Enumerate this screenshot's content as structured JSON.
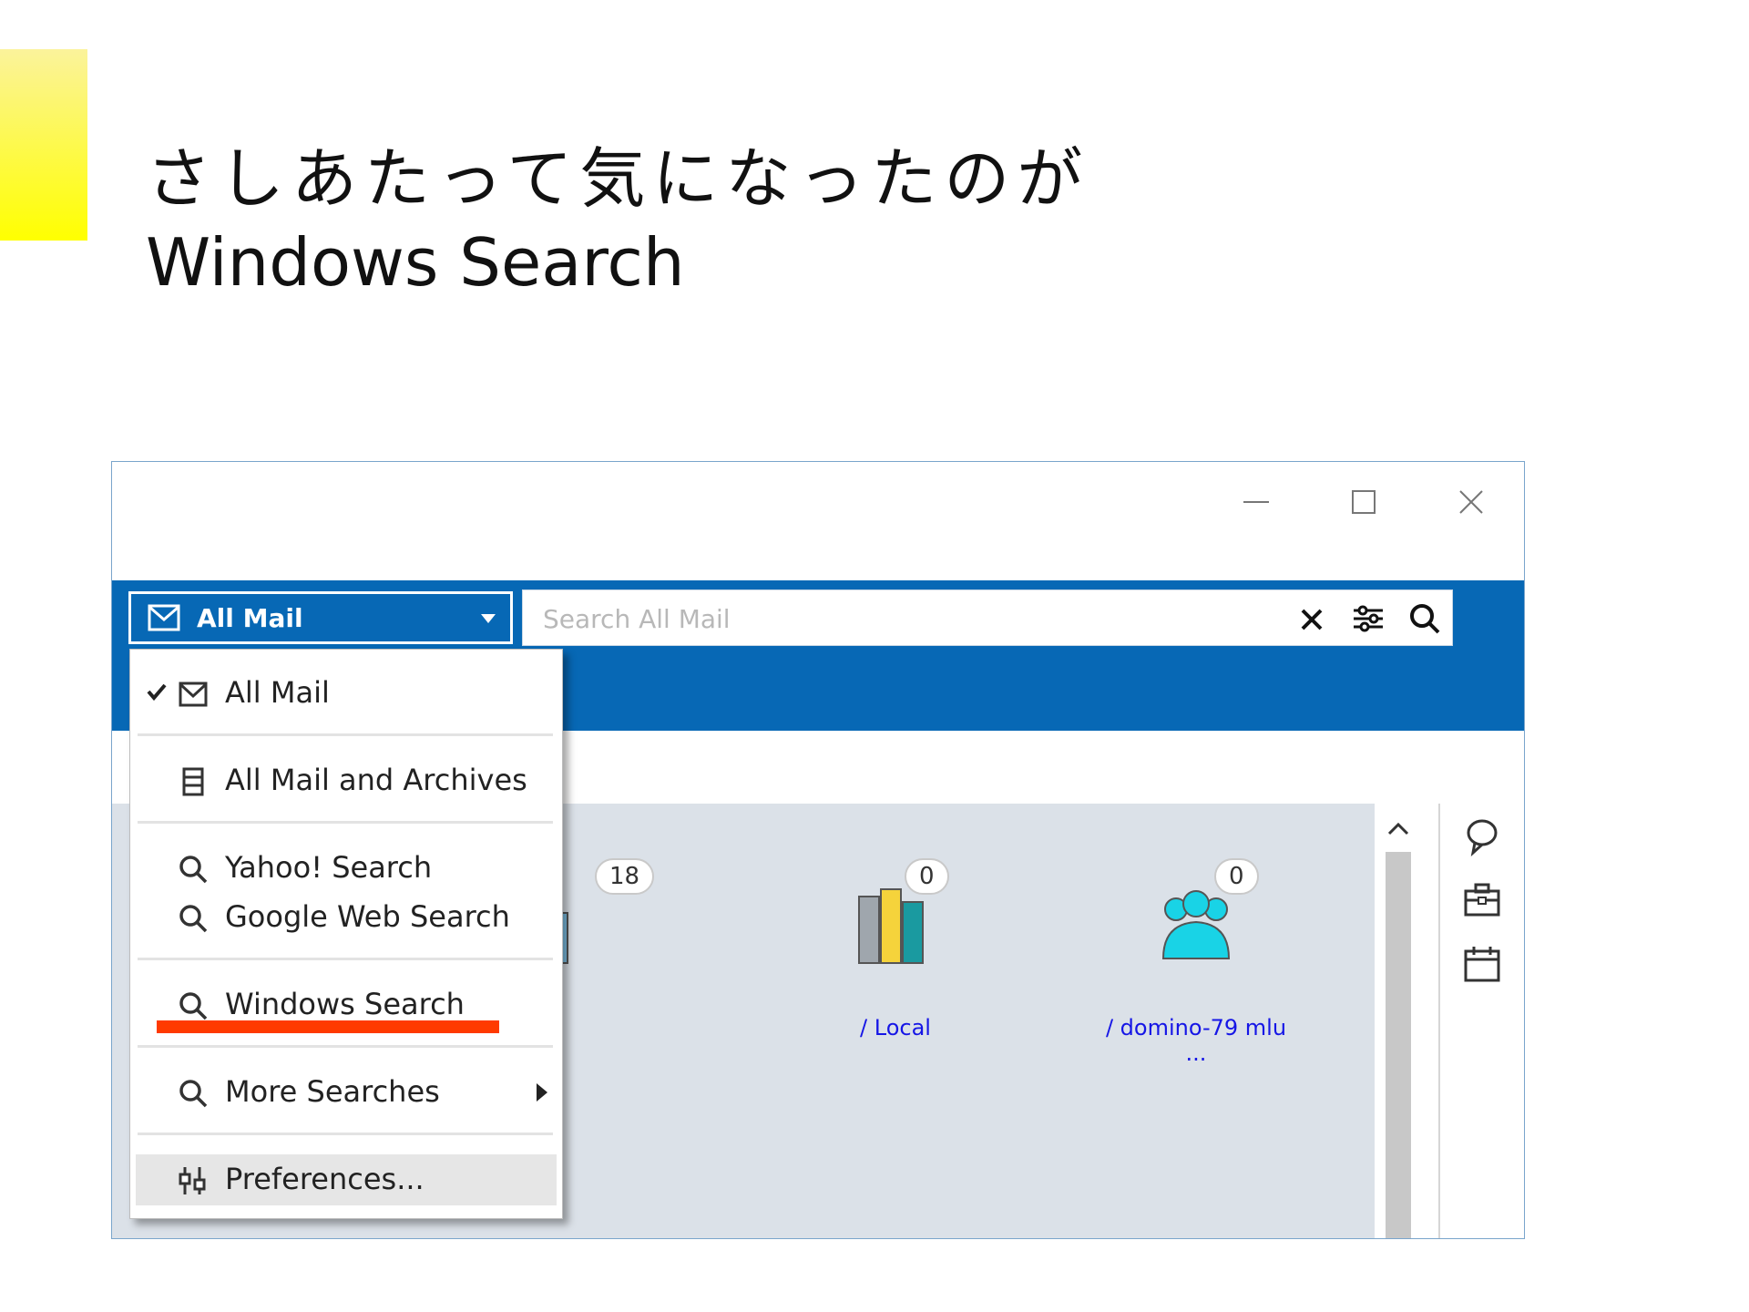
{
  "slide": {
    "title_line1": "さしあたって気になったのが",
    "title_line2": "Windows Search",
    "accent_color": "#ffff00",
    "underline_color": "#ff3a00"
  },
  "window": {
    "controls": [
      "minimize-icon",
      "maximize-icon",
      "close-icon"
    ],
    "toolbar_color": "#0768b5"
  },
  "scope": {
    "label": "All Mail",
    "icon": "mail-icon",
    "dropdown_icon": "chevron-down-icon"
  },
  "search": {
    "placeholder": "Search All Mail",
    "value": "",
    "actions": [
      "clear-icon",
      "search-options-icon",
      "search-icon"
    ]
  },
  "menu": {
    "items": [
      {
        "label": "All Mail",
        "icon": "mail-icon",
        "checked": true
      },
      {
        "label": "All Mail and Archives",
        "icon": "archive-icon",
        "checked": false
      },
      {
        "label": "Yahoo! Search",
        "icon": "search-icon",
        "checked": false
      },
      {
        "label": "Google Web Search",
        "icon": "search-icon",
        "checked": false
      },
      {
        "label": "Windows Search",
        "icon": "search-icon",
        "checked": false,
        "highlighted": true
      },
      {
        "label": "More Searches",
        "icon": "search-icon",
        "checked": false,
        "submenu": true
      },
      {
        "label": "Preferences...",
        "icon": "preferences-icon",
        "checked": false,
        "hovered": true
      }
    ]
  },
  "tiles": [
    {
      "badge": "18",
      "name": "",
      "server": "",
      "icon": "library-icon"
    },
    {
      "badge": "0",
      "name": "",
      "server": "/ Local",
      "icon": "library-icon"
    },
    {
      "badge": "0",
      "name": "",
      "server": "/ domino-79 mlu ...",
      "icon": "people-icon"
    }
  ],
  "side_rail": {
    "icons": [
      "chat-icon",
      "toolbox-icon",
      "calendar-icon"
    ]
  }
}
